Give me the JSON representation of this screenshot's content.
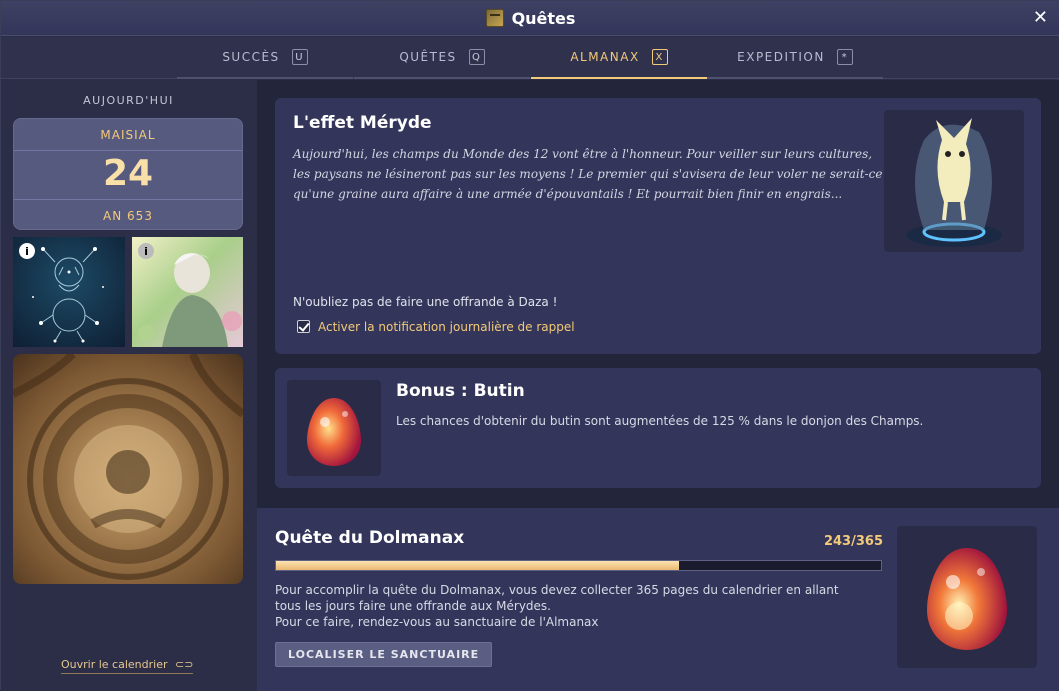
{
  "window": {
    "title": "Quêtes",
    "close": "✕"
  },
  "tabs": [
    {
      "label": "SUCCÈS",
      "key": "U"
    },
    {
      "label": "QUÊTES",
      "key": "Q"
    },
    {
      "label": "ALMANAX",
      "key": "X"
    },
    {
      "label": "EXPEDITION",
      "key": "*"
    }
  ],
  "active_tab": "ALMANAX",
  "sidebar": {
    "today_label": "AUJOURD'HUI",
    "month": "MAISIAL",
    "day": "24",
    "year": "AN 653",
    "calendar_link": "Ouvrir le calendrier",
    "info_icon": "i"
  },
  "event": {
    "title": "L'effet Méryde",
    "description": "Aujourd'hui, les champs du Monde des 12 vont être à l'honneur. Pour veiller sur leurs cultures, les paysans ne lésineront pas sur les moyens ! Le premier qui s'avisera de leur voler ne serait-ce qu'une graine aura affaire à une armée d'épouvantails ! Et pourrait bien finir en engrais...",
    "offering": "N'oubliez pas de faire une offrande à Daza !",
    "notification_label": "Activer la notification journalière de rappel",
    "notification_checked": true
  },
  "bonus": {
    "title": "Bonus : Butin",
    "text": "Les chances d'obtenir du butin sont augmentées de 125 % dans le donjon des Champs."
  },
  "dolmanax": {
    "title": "Quête du Dolmanax",
    "count": "243/365",
    "progress": 0.666,
    "text1": "Pour accomplir la quête du Dolmanax, vous devez collecter 365 pages du calendrier en allant",
    "text2": "tous les jours faire une offrande aux Mérydes.",
    "text3": "Pour ce faire, rendez-vous au sanctuaire de l'Almanax",
    "button": "LOCALISER LE SANCTUAIRE"
  },
  "colors": {
    "accent": "#f3c97a",
    "panel": "#33365a",
    "background": "#23253b"
  }
}
